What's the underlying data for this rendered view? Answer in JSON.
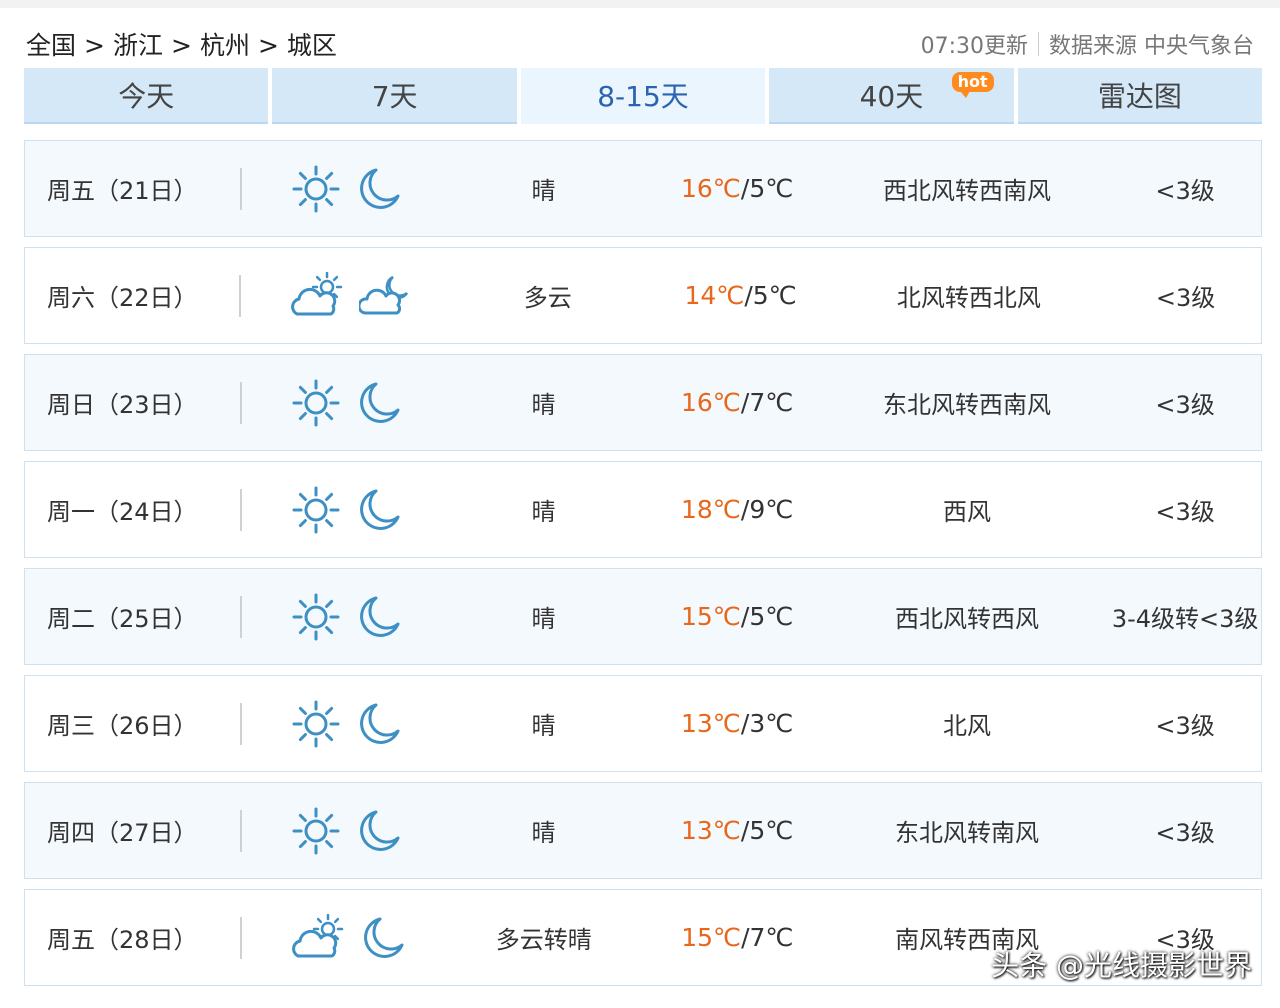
{
  "breadcrumb": {
    "items": [
      "全国",
      "浙江",
      "杭州",
      "城区"
    ],
    "sep": ">"
  },
  "update": {
    "time": "07:30更新",
    "source": "数据来源 中央气象台"
  },
  "tabs": [
    {
      "label": "今天",
      "active": false
    },
    {
      "label": "7天",
      "active": false
    },
    {
      "label": "8-15天",
      "active": true
    },
    {
      "label": "40天",
      "active": false,
      "badge": "hot"
    },
    {
      "label": "雷达图",
      "active": false
    }
  ],
  "days": [
    {
      "day": "周五（21日）",
      "icon_day": "sun-icon",
      "icon_night": "moon-icon",
      "desc": "晴",
      "hi": "16℃",
      "lo": "5℃",
      "wind": "西北风转西南风",
      "level": "<3级"
    },
    {
      "day": "周六（22日）",
      "icon_day": "cloudy-sun-icon",
      "icon_night": "cloudy-moon-icon",
      "desc": "多云",
      "hi": "14℃",
      "lo": "5℃",
      "wind": "北风转西北风",
      "level": "<3级"
    },
    {
      "day": "周日（23日）",
      "icon_day": "sun-icon",
      "icon_night": "moon-icon",
      "desc": "晴",
      "hi": "16℃",
      "lo": "7℃",
      "wind": "东北风转西南风",
      "level": "<3级"
    },
    {
      "day": "周一（24日）",
      "icon_day": "sun-icon",
      "icon_night": "moon-icon",
      "desc": "晴",
      "hi": "18℃",
      "lo": "9℃",
      "wind": "西风",
      "level": "<3级"
    },
    {
      "day": "周二（25日）",
      "icon_day": "sun-icon",
      "icon_night": "moon-icon",
      "desc": "晴",
      "hi": "15℃",
      "lo": "5℃",
      "wind": "西北风转西风",
      "level": "3-4级转<3级"
    },
    {
      "day": "周三（26日）",
      "icon_day": "sun-icon",
      "icon_night": "moon-icon",
      "desc": "晴",
      "hi": "13℃",
      "lo": "3℃",
      "wind": "北风",
      "level": "<3级"
    },
    {
      "day": "周四（27日）",
      "icon_day": "sun-icon",
      "icon_night": "moon-icon",
      "desc": "晴",
      "hi": "13℃",
      "lo": "5℃",
      "wind": "东北风转南风",
      "level": "<3级"
    },
    {
      "day": "周五（28日）",
      "icon_day": "cloudy-sun-icon",
      "icon_night": "moon-icon",
      "desc": "多云转晴",
      "hi": "15℃",
      "lo": "7℃",
      "wind": "南风转西南风",
      "level": "<3级"
    }
  ],
  "watermark": "头条 @光线摄影世界",
  "colors": {
    "hi_temp": "#e8671a",
    "tab_bg": "#d4e8f8",
    "tab_active_text": "#2b63b3",
    "icon_stroke": "#3d8fc4"
  }
}
